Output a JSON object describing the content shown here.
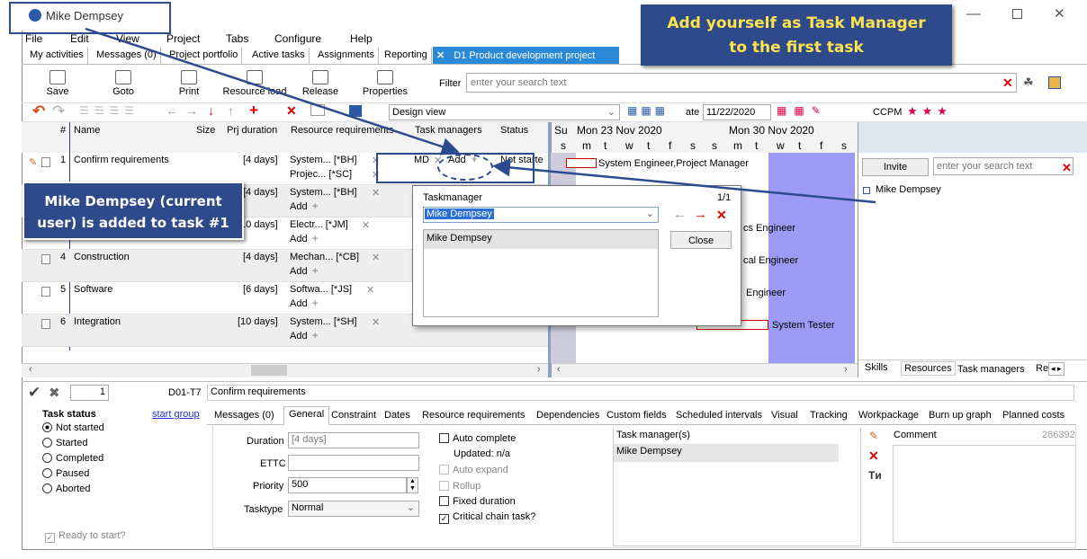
{
  "window": {
    "title": "Mike Dempsey"
  },
  "menu": [
    "File",
    "Edit",
    "View",
    "Project",
    "Tabs",
    "Configure",
    "Help"
  ],
  "tabs": [
    {
      "label": "My activities"
    },
    {
      "label": "Messages (0)"
    },
    {
      "label": "Project portfolio"
    },
    {
      "label": "Active tasks"
    },
    {
      "label": "Assignments"
    },
    {
      "label": "Reporting"
    }
  ],
  "active_tab": {
    "label": "D1 Product development project"
  },
  "toolbar": {
    "save": "Save",
    "goto": "Goto",
    "print": "Print",
    "resource_load": "Resource load",
    "release": "Release",
    "properties": "Properties"
  },
  "filter": {
    "label": "Filter",
    "placeholder": "enter your search text"
  },
  "view_select": "Design view",
  "date_label": "ate",
  "date_value": "11/22/2020",
  "ccpm": "CCPM",
  "grid": {
    "headers": {
      "num": "#",
      "name": "Name",
      "size": "Size",
      "duration": "Prj duration",
      "resources": "Resource requirements",
      "task_managers": "Task managers",
      "status": "Status"
    },
    "rows": [
      {
        "num": "1",
        "name": "Confirm requirements",
        "duration": "[4 days]",
        "res1": "System... [*BH]",
        "res2": "Projec... [*SC]",
        "tm": "MD",
        "tm_add": "Add",
        "status": "Not starte"
      },
      {
        "num": "2",
        "name": "",
        "duration": "[4 days]",
        "res1": "System... [*BH]",
        "res2": "Add",
        "tm": "",
        "tm_add": "",
        "status": ""
      },
      {
        "num": "3",
        "name": "",
        "duration": "[10 days]",
        "res1": "Electr... [*JM]",
        "res2": "Add",
        "tm": "",
        "tm_add": "",
        "status": ""
      },
      {
        "num": "4",
        "name": "Construction",
        "duration": "[4 days]",
        "res1": "Mechan... [*CB]",
        "res2": "Add",
        "tm": "",
        "tm_add": "",
        "status": ""
      },
      {
        "num": "5",
        "name": "Software",
        "duration": "[6 days]",
        "res1": "Softwa... [*JS]",
        "res2": "Add",
        "tm": "",
        "tm_add": "",
        "status": ""
      },
      {
        "num": "6",
        "name": "Integration",
        "duration": "[10 days]",
        "res1": "System... [*SH]",
        "res2": "Add",
        "tm": "",
        "tm_add": "",
        "status": ""
      }
    ]
  },
  "gantt": {
    "week1": "Mon 23 Nov 2020",
    "week2": "Mon 30 Nov 2020",
    "su": "Su",
    "days": [
      "s",
      "m",
      "t",
      "w",
      "t",
      "f",
      "s",
      "s",
      "m",
      "t",
      "w",
      "t",
      "f",
      "s"
    ],
    "labels": [
      "System Engineer,Project Manager",
      "cs Engineer",
      "cal Engineer",
      "Engineer",
      "System Tester"
    ]
  },
  "right_panel": {
    "invite": "Invite",
    "placeholder": "enter your search text",
    "person": "Mike Dempsey",
    "tabs": [
      "Skills",
      "Resources",
      "Task managers",
      "Re"
    ]
  },
  "popup": {
    "title": "Taskmanager",
    "count": "1/1",
    "selected": "Mike Dempsey",
    "list_item": "Mike Dempsey",
    "close": "Close"
  },
  "detail": {
    "row_num": "1",
    "task_id": "D01-T7",
    "task_name": "Confirm requirements",
    "status_title": "Task status",
    "start_group": "start group",
    "statuses": [
      "Not started",
      "Started",
      "Completed",
      "Paused",
      "Aborted"
    ],
    "ready": "Ready to start?",
    "tabs": [
      "Messages (0)",
      "General",
      "Constraint",
      "Dates",
      "Resource requirements",
      "Dependencies",
      "Custom fields",
      "Scheduled intervals",
      "Visual",
      "Tracking",
      "Workpackage",
      "Burn up graph",
      "Planned costs"
    ],
    "duration_label": "Duration",
    "duration_value": "[4 days]",
    "ettc_label": "ETTC",
    "priority_label": "Priority",
    "priority_value": "500",
    "tasktype_label": "Tasktype",
    "tasktype_value": "Normal",
    "auto_complete": "Auto complete",
    "updated": "Updated: n/a",
    "auto_expand": "Auto expand",
    "rollup": "Rollup",
    "fixed_duration": "Fixed duration",
    "critical_chain": "Critical chain task?",
    "tm_header": "Task manager(s)",
    "tm_value": "Mike Dempsey",
    "comment": "Comment",
    "comment_id": "286392"
  },
  "callouts": {
    "top": "Add yourself as Task Manager to the first task",
    "left": "Mike Dempsey (current user) is added to task #1"
  },
  "colors": {
    "accent": "#2e4a8a",
    "callout_text": "#ffe34d",
    "gantt_weekend": "#9b9bf5",
    "arrow": "#2b4b8f"
  }
}
